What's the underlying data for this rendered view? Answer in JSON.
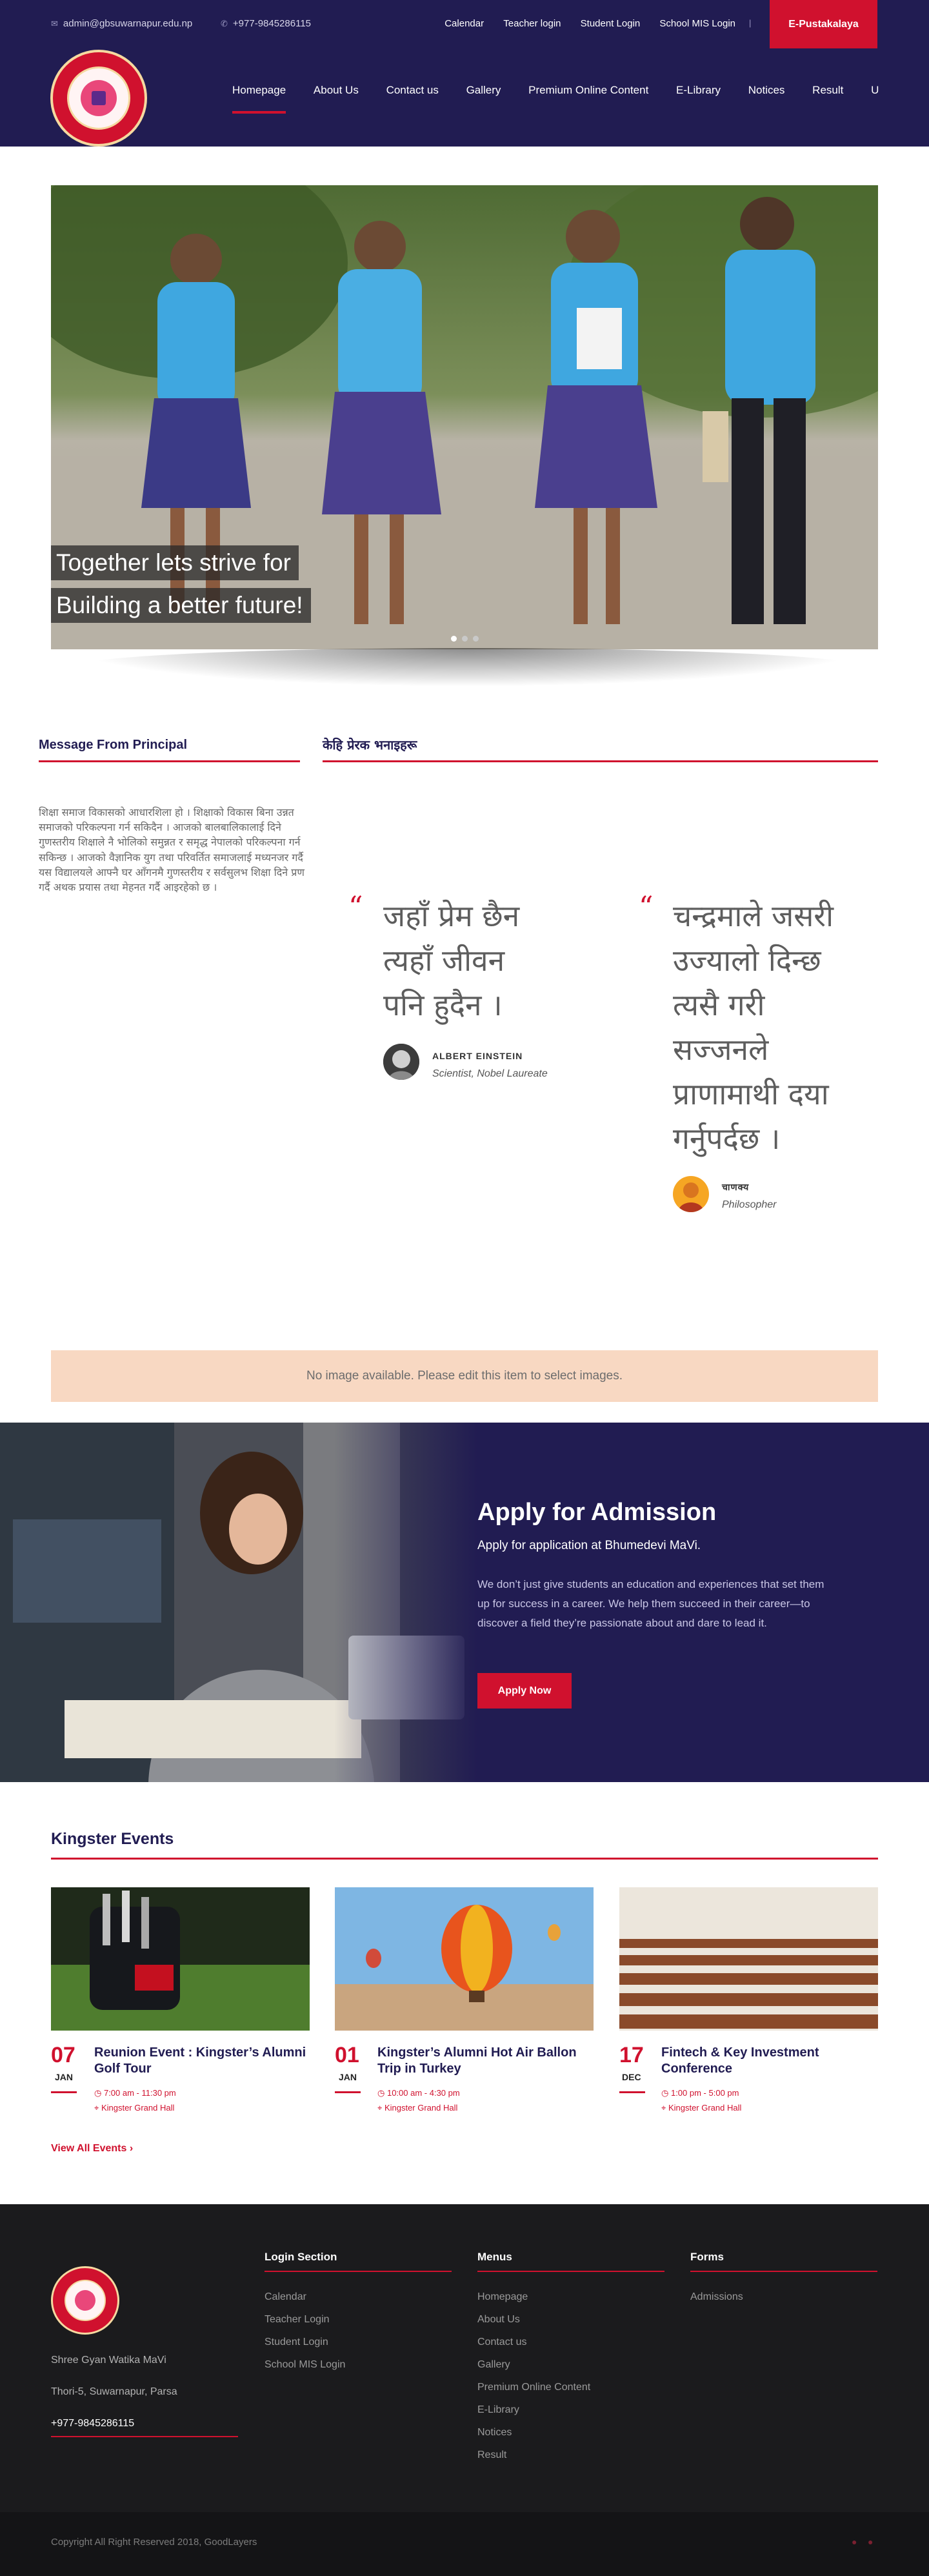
{
  "topbar": {
    "email": "admin@gbsuwarnapur.edu.np",
    "phone": "+977-9845286115",
    "links": [
      "Calendar",
      "Teacher login",
      "Student Login",
      "School MIS Login"
    ],
    "cta": "E-Pustakalaya"
  },
  "nav": {
    "items": [
      "Homepage",
      "About Us",
      "Contact us",
      "Gallery",
      "Premium Online Content",
      "E-Library",
      "Notices",
      "Result",
      "U"
    ],
    "active": "Homepage"
  },
  "hero": {
    "caption_line1": "Together lets strive for",
    "caption_line2": "Building a better future!"
  },
  "principal": {
    "title": "Message From Principal",
    "text": "शिक्षा समाज विकासको आधारशिला हो । शिक्षाको विकास बिना उन्नत समाजको परिकल्पना गर्न सकिदैन । आजको बालबालिकालाई दिने गुणस्तरीय शिक्षाले नै भोलिको समुन्नत र समृद्ध नेपालको परिकल्पना गर्न सकिन्छ । आजको वैज्ञानिक युग तथा परिवर्तित समाजलाई मध्यनजर गर्दै यस विद्यालयले आफ्नै घर आँगनमै गुणस्तरीय र सर्वसुलभ शिक्षा दिने प्रण गर्दै अथक प्रयास तथा मेहनत गर्दै आइरहेको छ ।"
  },
  "quotes": {
    "title": "केहि प्रेरक भनाइहरू",
    "items": [
      {
        "text": "जहाँ प्रेम छैन त्यहाँ जीवन पनि हुदैन ।",
        "author": "ALBERT EINSTEIN",
        "role": "Scientist, Nobel Laureate"
      },
      {
        "text": "चन्द्रमाले जसरी उज्यालो दिन्छ त्यसै गरी सज्जनले प्राणामाथी दया गर्नुपर्दछ ।",
        "author": "चाणक्य",
        "role": "Philosopher"
      }
    ]
  },
  "notice_box": "No image available. Please edit this item to select images.",
  "admission": {
    "title": "Apply for Admission",
    "subtitle": "Apply for application at Bhumedevi MaVi.",
    "body": "We don’t just give students an education and experiences that set them up for success in a career. We help them succeed in their career—to discover a field they’re passionate about and dare to lead it.",
    "button": "Apply Now"
  },
  "events": {
    "title": "Kingster Events",
    "items": [
      {
        "day": "07",
        "month": "JAN",
        "title": "Reunion Event : Kingster’s Alumni Golf Tour",
        "time": "7:00 am - 11:30 pm",
        "place": "Kingster Grand Hall"
      },
      {
        "day": "01",
        "month": "JAN",
        "title": "Kingster’s Alumni Hot Air Ballon Trip in Turkey",
        "time": "10:00 am - 4:30 pm",
        "place": "Kingster Grand Hall"
      },
      {
        "day": "17",
        "month": "DEC",
        "title": "Fintech & Key Investment Conference",
        "time": "1:00 pm - 5:00 pm",
        "place": "Kingster Grand Hall"
      }
    ],
    "view_all": "View All Events"
  },
  "footer": {
    "school_name": "Shree Gyan Watika MaVi",
    "address": "Thori-5, Suwarnapur, Parsa",
    "phone": "+977-9845286115",
    "login_title": "Login Section",
    "login_links": [
      "Calendar",
      "Teacher Login",
      "Student Login",
      "School MIS Login"
    ],
    "menus_title": "Menus",
    "menu_links": [
      "Homepage",
      "About Us",
      "Contact us",
      "Gallery",
      "Premium Online Content",
      "E-Library",
      "Notices",
      "Result"
    ],
    "forms_title": "Forms",
    "form_links": [
      "Admissions"
    ],
    "copyright": "Copyright All Right Reserved 2018, GoodLayers"
  }
}
